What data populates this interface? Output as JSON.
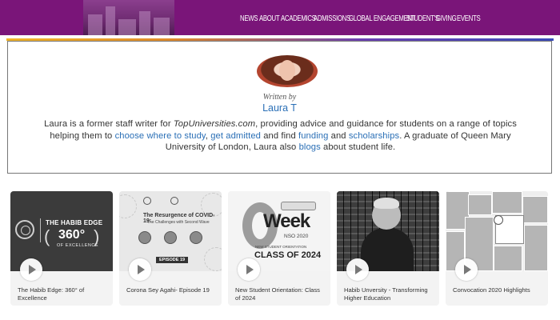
{
  "header": {
    "nav": [
      "NEWS",
      "ABOUT",
      "ACADEMICS",
      "ADMISSIONS",
      "GLOBAL ENGAGEMENT",
      "STUDENT'S",
      "GIVING",
      "EVENTS"
    ]
  },
  "author": {
    "written_by": "Written by",
    "name": "Laura T",
    "bio": {
      "p1": "Laura is a former staff writer for ",
      "site": "TopUniversities.com",
      "p2": ", providing advice and guidance for students on a range of topics helping them to ",
      "link_study": "choose where to study",
      "p3": ", ",
      "link_admitted": "get admitted",
      "p4": " and find ",
      "link_funding": "funding",
      "p5": " and ",
      "link_scholarships": "scholarships",
      "p6": ". A graduate of Queen Mary University of London, Laura also ",
      "link_blogs": "blogs",
      "p7": " about student life."
    }
  },
  "videos": [
    {
      "caption": "The Habib Edge: 360° of Excellence",
      "thumb": {
        "line1": "THE HABIB EDGE",
        "line2": "360°",
        "line3": "OF EXCELLENCE"
      }
    },
    {
      "caption": "Corona Sey Agahi- Episode 19",
      "thumb": {
        "title": "The Resurgence of COVID-19:",
        "sub": "The Challenges with Second Wave",
        "episode": "EPISODE 19"
      }
    },
    {
      "caption": "New Student Orientation: Class of 2024",
      "thumb": {
        "week": "Week",
        "nso": "NSO 2020",
        "orientation": "NEW STUDENT ORIENTATION",
        "class": "CLASS OF 2024"
      }
    },
    {
      "caption": "Habib Unversity - Transforming Higher Education",
      "thumb": {}
    },
    {
      "caption": "Convocation 2020 Highlights",
      "thumb": {}
    }
  ],
  "colors": {
    "nav_bg": "#7a1579",
    "link": "#2a6fb6"
  }
}
